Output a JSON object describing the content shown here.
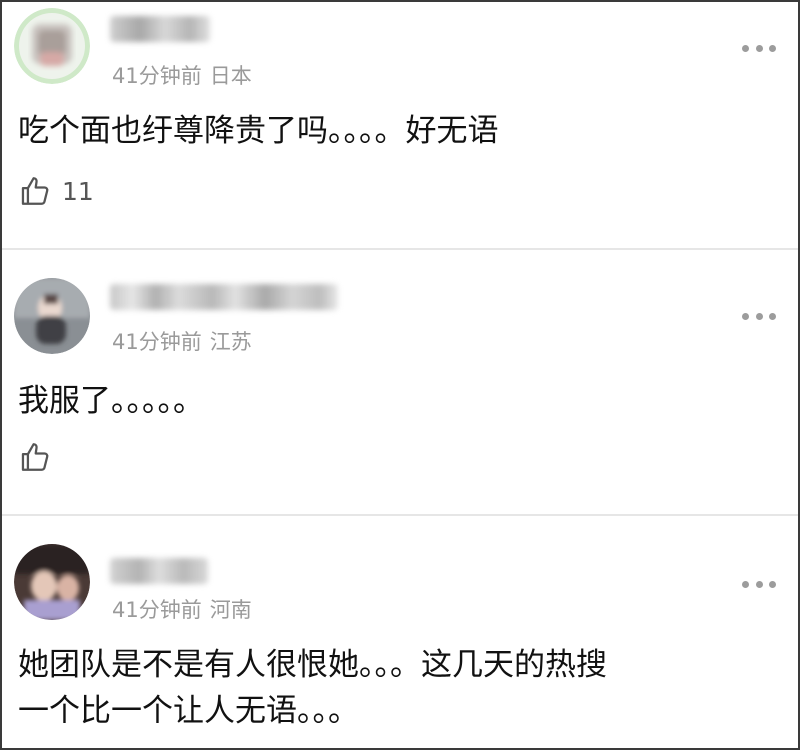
{
  "comments": [
    {
      "time": "41分钟前",
      "location": "日本",
      "text_lines": [
        "吃个面也纡尊降贵了吗。。。。好无语"
      ],
      "likes": "11"
    },
    {
      "time": "41分钟前",
      "location": "江苏",
      "text_lines": [
        "我服了。。。。。"
      ],
      "likes": ""
    },
    {
      "time": "41分钟前",
      "location": "河南",
      "text_lines": [
        "她团队是不是有人很恨她。。。这几天的热搜",
        "一个比一个让人无语。。。"
      ]
    }
  ],
  "icons": {
    "more": "more-dots-icon",
    "like": "thumbs-up-icon"
  },
  "colors": {
    "meta_text": "#9a9a9a",
    "body_text": "#111111",
    "divider": "#e6e6e6",
    "frame_border": "#3a3a3a"
  }
}
